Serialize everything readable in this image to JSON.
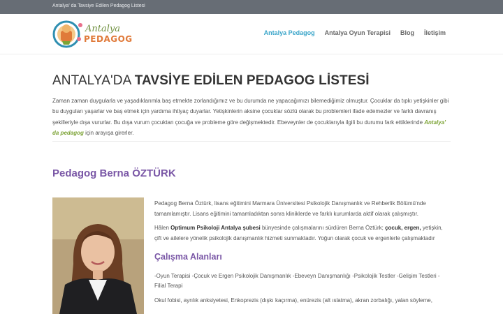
{
  "topbar": {
    "text": "Antalya' da Tavsiye Edilen Pedagog Listesi"
  },
  "logo": {
    "line1": "Antalya",
    "line2": "PEDAGOG"
  },
  "nav": {
    "items": [
      {
        "label": "Antalya Pedagog",
        "active": true
      },
      {
        "label": "Antalya Oyun Terapisi",
        "active": false
      },
      {
        "label": "Blog",
        "active": false
      },
      {
        "label": "İletişim",
        "active": false
      }
    ]
  },
  "main": {
    "title_normal": "ANTALYA'DA ",
    "title_bold": "TAVSİYE EDİLEN PEDAGOG LİSTESİ",
    "intro_part1": "Zaman zaman duygularla ve yaşadıklarımla baş etmekte zorlandığımız ve bu durumda ne yapacağımızı bilemediğimiz olmuştur. Çocuklar da tıpkı yetişkinler gibi bu duyguları yaşarlar ve baş etmek için yardıma ihtiyaç duyarlar. Yetişkinlerin aksine çocuklar sözlü olarak bu problemleri ifade edemezler ve farklı davranış şekilleriyle dışa vururlar. Bu dışa vurum çocuktan çocuğa ve probleme göre değişmektedir. Ebeveynler de çocuklarıyla ilgili bu durumu fark ettiklerinde ",
    "intro_highlight": "Antalya' da pedagog",
    "intro_part2": " için arayışa girerler.",
    "name_heading": "Pedagog Berna ÖZTÜRK",
    "bio_p1": "Pedagog Berna Öztürk, lisans eğitimini Marmara Üniversitesi Psikolojik Danışmanlık ve Rehberlik Bölümü'nde tamamlamıştır. Lisans eğitimini tamamladıktan sonra kliniklerde ve farklı kurumlarda aktif olarak çalışmıştır.",
    "bio_p2_a": "Hâlen ",
    "bio_p2_b": "Optimum Psikoloji Antalya şubesi",
    "bio_p2_c": " bünyesinde çalışmalarını sürdüren Berna Öztürk; ",
    "bio_p2_d": "çocuk, ergen,",
    "bio_p2_e": " yetişkin, çift ve ailelere yönelik psikolojik danışmanlık hizmeti sunmaktadır. Yoğun olarak çocuk ve ergenlerle çalışmaktadır",
    "section_title": "Çalışma Alanları",
    "areas": "-Oyun Terapisi -Çocuk ve Ergen Psikolojik Danışmanlık -Ebeveyn Danışmanlığı -Psikolojik Testler -Gelişim Testleri -Filial Terapi",
    "bio_p3": "Okul fobisi, ayrılık anksiyetesi, Enkoprezis (dışkı kaçırma), enürezis (alt ıslatma), akran zorbalığı, yalan söyleme,"
  },
  "colors": {
    "accent_nav": "#3aa5c9",
    "heading_purple": "#7a57a6",
    "highlight_green": "#7ca335",
    "topbar_bg": "#676d75"
  }
}
